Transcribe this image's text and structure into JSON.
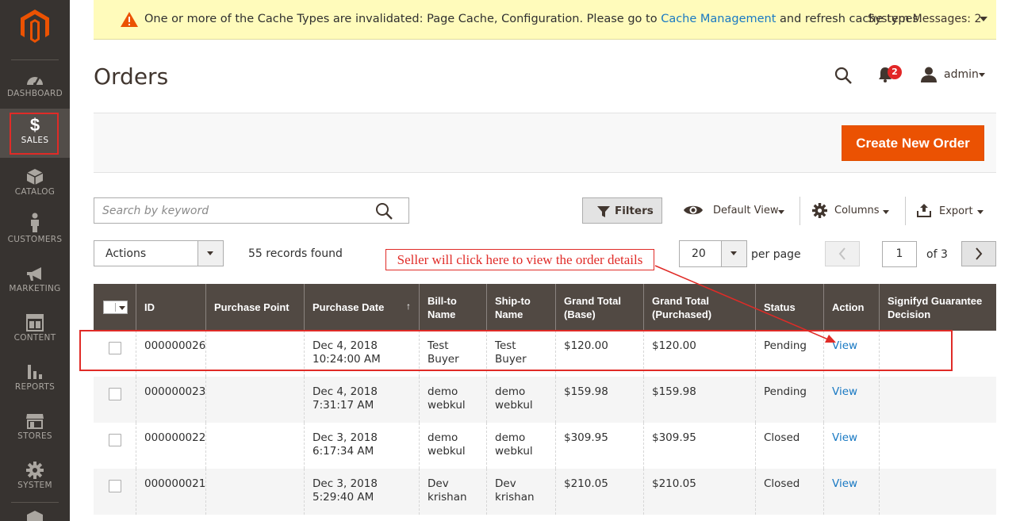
{
  "sidebar": {
    "items": [
      {
        "label": "DASHBOARD",
        "icon": "gauge-icon"
      },
      {
        "label": "SALES",
        "icon": "dollar-icon",
        "active": true
      },
      {
        "label": "CATALOG",
        "icon": "box-icon"
      },
      {
        "label": "CUSTOMERS",
        "icon": "person-icon"
      },
      {
        "label": "MARKETING",
        "icon": "megaphone-icon"
      },
      {
        "label": "CONTENT",
        "icon": "layout-icon"
      },
      {
        "label": "REPORTS",
        "icon": "bar-chart-icon"
      },
      {
        "label": "STORES",
        "icon": "storefront-icon"
      },
      {
        "label": "SYSTEM",
        "icon": "gear-icon"
      }
    ]
  },
  "notice": {
    "before_link": "One or more of the Cache Types are invalidated: Page Cache, Configuration. Please go to ",
    "link": "Cache Management",
    "after_link": " and refresh cache types.",
    "system_messages": "System Messages: 2"
  },
  "header": {
    "title": "Orders",
    "notification_count": "2",
    "user": "admin"
  },
  "toolbar": {
    "create_label": "Create New Order",
    "search_placeholder": "Search by keyword",
    "filters_label": "Filters",
    "view_label": "Default View",
    "columns_label": "Columns",
    "export_label": "Export",
    "actions_label": "Actions",
    "records_found": "55 records found",
    "per_page_value": "20",
    "per_page_label": "per page",
    "current_page": "1",
    "total_pages": "of 3"
  },
  "annotation": {
    "text": "Seller will click here to view the order details"
  },
  "grid": {
    "columns": [
      "ID",
      "Purchase Point",
      "Purchase Date",
      "Bill-to Name",
      "Ship-to Name",
      "Grand Total (Base)",
      "Grand Total (Purchased)",
      "Status",
      "Action",
      "Signifyd Guarantee Decision"
    ],
    "sort_indicator": "↑",
    "rows": [
      {
        "id": "000000026",
        "point": "",
        "date": "Dec 4, 2018 10:24:00 AM",
        "bill": "Test Buyer",
        "ship": "Test Buyer",
        "base": "$120.00",
        "purchased": "$120.00",
        "status": "Pending",
        "action": "View",
        "decision": ""
      },
      {
        "id": "000000023",
        "point": "",
        "date": "Dec 4, 2018 7:31:17 AM",
        "bill": "demo webkul",
        "ship": "demo webkul",
        "base": "$159.98",
        "purchased": "$159.98",
        "status": "Pending",
        "action": "View",
        "decision": ""
      },
      {
        "id": "000000022",
        "point": "",
        "date": "Dec 3, 2018 6:17:34 AM",
        "bill": "demo webkul",
        "ship": "demo webkul",
        "base": "$309.95",
        "purchased": "$309.95",
        "status": "Closed",
        "action": "View",
        "decision": ""
      },
      {
        "id": "000000021",
        "point": "",
        "date": "Dec 3, 2018 5:29:40 AM",
        "bill": "Dev krishan",
        "ship": "Dev krishan",
        "base": "$210.05",
        "purchased": "$210.05",
        "status": "Closed",
        "action": "View",
        "decision": ""
      }
    ]
  },
  "colors": {
    "accent": "#eb5202",
    "sidebar": "#373330",
    "grid_header": "#514943",
    "link": "#1979c3",
    "annotation": "#e02b27"
  }
}
